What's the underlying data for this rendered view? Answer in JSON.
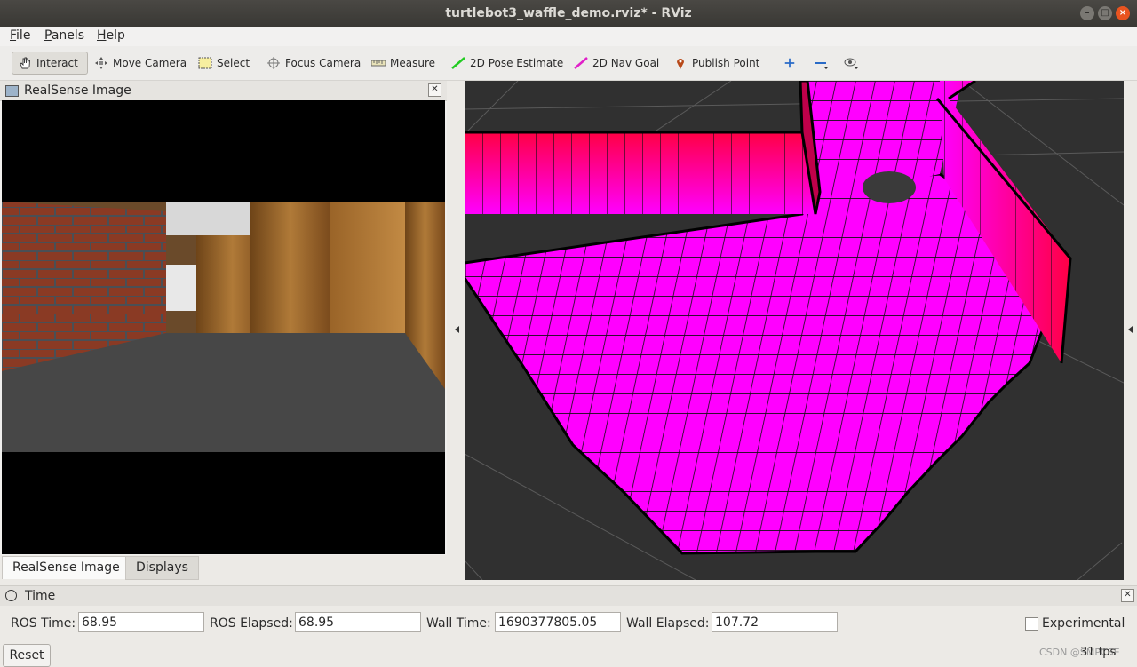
{
  "window": {
    "title": "turtlebot3_waffle_demo.rviz* - RViz"
  },
  "menu": [
    {
      "label": "File",
      "mnemonic": "F",
      "rest": "ile"
    },
    {
      "label": "Panels",
      "mnemonic": "P",
      "rest": "anels"
    },
    {
      "label": "Help",
      "mnemonic": "H",
      "rest": "elp"
    }
  ],
  "toolbar": {
    "interact": "Interact",
    "move_camera": "Move Camera",
    "select": "Select",
    "focus_camera": "Focus Camera",
    "measure": "Measure",
    "pose_estimate": "2D Pose Estimate",
    "nav_goal": "2D Nav Goal",
    "publish_point": "Publish Point",
    "active_tool": "Interact"
  },
  "image_panel": {
    "title": "RealSense Image"
  },
  "tabs": [
    {
      "label": "RealSense Image",
      "selected": true
    },
    {
      "label": "Displays",
      "selected": false
    }
  ],
  "time_panel": {
    "title": "Time",
    "ros_time_label": "ROS Time:",
    "ros_time": "68.95",
    "ros_elapsed_label": "ROS Elapsed:",
    "ros_elapsed": "68.95",
    "wall_time_label": "Wall Time:",
    "wall_time": "1690377805.05",
    "wall_elapsed_label": "Wall Elapsed:",
    "wall_elapsed": "107.72",
    "experimental_label": "Experimental",
    "experimental_checked": false,
    "reset_label": "Reset",
    "fps": "31 fps"
  },
  "watermark": "CSDN @SMPCSE",
  "colors": {
    "map_cell_near": "#ff00ff",
    "map_cell_far": "#ff0044",
    "viewport_bg": "#303030",
    "title_bar": "#3c3b37",
    "close_button": "#e95420"
  }
}
